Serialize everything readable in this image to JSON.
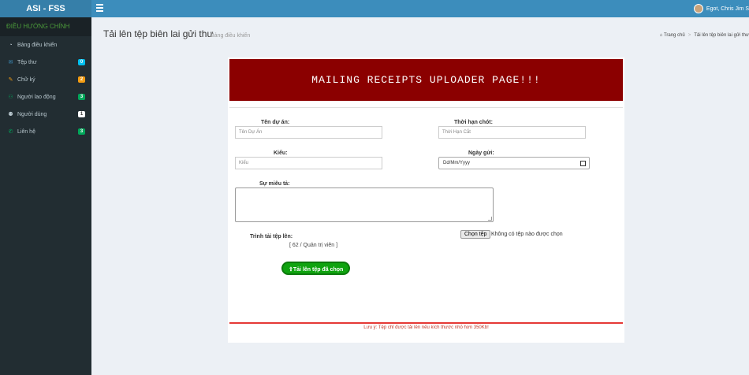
{
  "app": {
    "brand": "ASI - FSS",
    "user_name": "Egot, Chris Jim S"
  },
  "sidebar": {
    "header": "ĐIỀU HƯỚNG CHÍNH",
    "items": [
      {
        "label": "Bảng điều khiển",
        "icon": "dashboard-icon",
        "badge": "",
        "badge_color": ""
      },
      {
        "label": "Tệp thư",
        "icon": "envelope-icon",
        "badge": "0",
        "badge_color": "#00c0ef"
      },
      {
        "label": "Chữ ký",
        "icon": "pencil-icon",
        "badge": "2",
        "badge_color": "#f39c12"
      },
      {
        "label": "Người lao động",
        "icon": "users-icon",
        "badge": "3",
        "badge_color": "#00a65a"
      },
      {
        "label": "Người dùng",
        "icon": "user-icon",
        "badge": "1",
        "badge_color": "#ffffff"
      },
      {
        "label": "Liên hệ",
        "icon": "phone-icon",
        "badge": "3",
        "badge_color": "#00a65a"
      }
    ]
  },
  "header": {
    "title": "Tải lên tệp biên lai gửi thư",
    "subtitle": "Bảng điều khiển",
    "breadcrumb_home": "Trang chủ",
    "breadcrumb_current": "Tải lên tệp biên lai gửi thư"
  },
  "form": {
    "banner": "MAILING RECEIPTS UPLOADER PAGE!!!",
    "project_label": "Tên dự án:",
    "project_placeholder": "Tên Dự Án",
    "deadline_label": "Thời hạn chót:",
    "deadline_placeholder": "Thời Hạn Cắt",
    "type_label": "Kiểu:",
    "type_placeholder": "Kiểu",
    "send_date_label": "Ngày gửi:",
    "send_date_value": "Dd/Mm/Yyyy",
    "description_label": "Sự miêu tả:",
    "uploader_label": "Trình tải tệp lên:",
    "uploader_value": "[ 62 / Quản trị viên ]",
    "choose_file_label": "Chọn tệp",
    "no_file_text": "Không có tệp nào được chọn",
    "upload_button_label": "Tải lên tệp đã chọn",
    "note": "Lưu ý: Tệp chỉ được tải lên nếu kích thước nhỏ hơn 350Kb!"
  },
  "colors": {
    "topbar": "#3c8dbc",
    "sidebar": "#222d32",
    "banner": "#8b0000",
    "upload": "#0fa30f",
    "note": "#c0392b"
  }
}
